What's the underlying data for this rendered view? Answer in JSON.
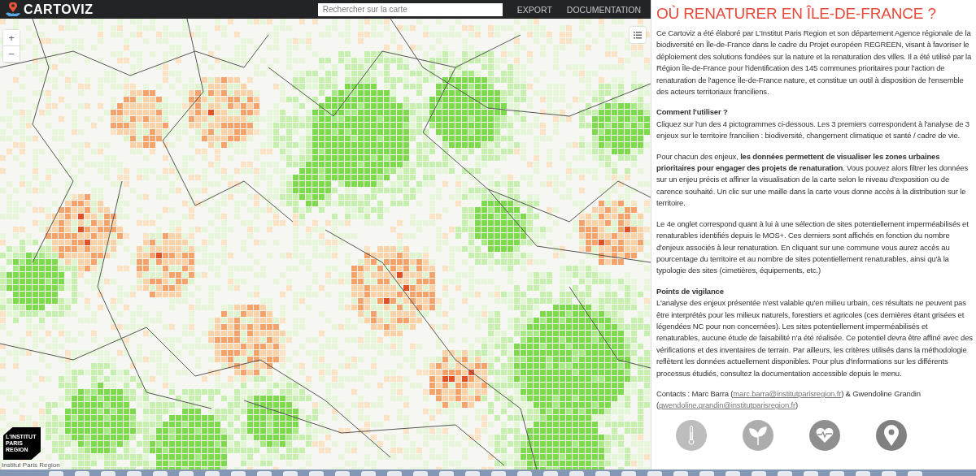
{
  "header": {
    "logo": "CARTOVIZ",
    "search": {
      "placeholder": "Rechercher sur la carte"
    },
    "menu": [
      "EXPORT",
      "DOCUMENTATION"
    ]
  },
  "map": {
    "zoom_in": "+",
    "zoom_out": "−",
    "logo_lines": [
      "L'INSTITUT",
      "PARIS",
      "REGION"
    ],
    "attribution": "Institut Paris Region"
  },
  "panel": {
    "title": "OÙ RENATURER EN ÎLE-DE-FRANCE ?",
    "sections": [
      {
        "paragraphs": [
          "Ce Cartoviz a été élaboré par L'Institut Paris Region et son département Agence régionale de la biodiversité en Île-de-France dans le cadre du Projet européen REGREEN, visant à favoriser le déploiement des solutions fondées sur la nature et la renaturation des villes. Il a été utilisé par la Région Île-de-France pour l'identification des 145 communes prioritaires pour l'action de renaturation de l'agence Île-de-France nature, et constitue un outil à disposition de l'ensemble des acteurs territoriaux franciliens."
        ]
      },
      {
        "heading": "Comment l'utiliser ?",
        "paragraphs": [
          "Cliquez sur l'un des 4 pictogrammes ci-dessous. Les 3 premiers correspondent à l'analyse de 3 enjeux sur le territoire francilien : biodiversité, changement climatique et santé / cadre de vie.",
          "Pour chacun des enjeux, **les données permettent de visualiser les zones urbaines prioritaires pour engager des projets de renaturation**. Vous pouvez alors filtrer les données sur un enjeu précis et affiner la visualisation de la carte selon le niveau d'exposition ou de carence souhaité. Un clic sur une maille dans la carte vous donne accès à la distribution sur le territoire.",
          "Le 4e onglet correspond quant à lui à une sélection de sites potentiellement imperméabilisés et renaturables identifiés depuis le MOS+. Ces derniers sont affichés en fonction du nombre d'enjeux associés à leur renaturation. En cliquant sur une commune vous aurez accès au pourcentage du territoire et au nombre de sites potentiellement renaturables, ainsi qu'à la typologie des sites (cimetières, équipements, etc.)"
        ]
      },
      {
        "heading": "Points de vigilance",
        "paragraphs": [
          "L'analyse des enjeux présentée n'est valable qu'en milieu urbain, ces résultats ne peuvent pas être interprétés pour les milieux naturels, forestiers et agricoles (ces dernières étant grisées et légendées NC pour non concernées). Les sites potentiellement imperméabilisés et renaturables, aucune étude de faisabilité n'a été réalisée. Ce potentiel devra être affiné avec des vérifications et des inventaires de terrain. Par ailleurs, les critères utilisés dans la méthodologie reflètent les données actuellement disponibles. Pour plus d'informations sur les différents processus étudiés, consultez la documentation accessible depuis le menu."
        ]
      }
    ],
    "contacts": [
      {
        "kind": "text",
        "text": "Contacts : Marc Barra ("
      },
      {
        "kind": "link",
        "text": "marc.barra@institutparisregion.fr"
      },
      {
        "kind": "text",
        "text": ") & Gwendoline Grandin ("
      },
      {
        "kind": "link",
        "text": "gwendoline.grandin@institutparisregion.fr"
      },
      {
        "kind": "text",
        "text": ")"
      }
    ],
    "pictograms": [
      {
        "kind": "thermometer"
      },
      {
        "kind": "leaf"
      },
      {
        "kind": "heart"
      },
      {
        "kind": "pin"
      }
    ]
  }
}
